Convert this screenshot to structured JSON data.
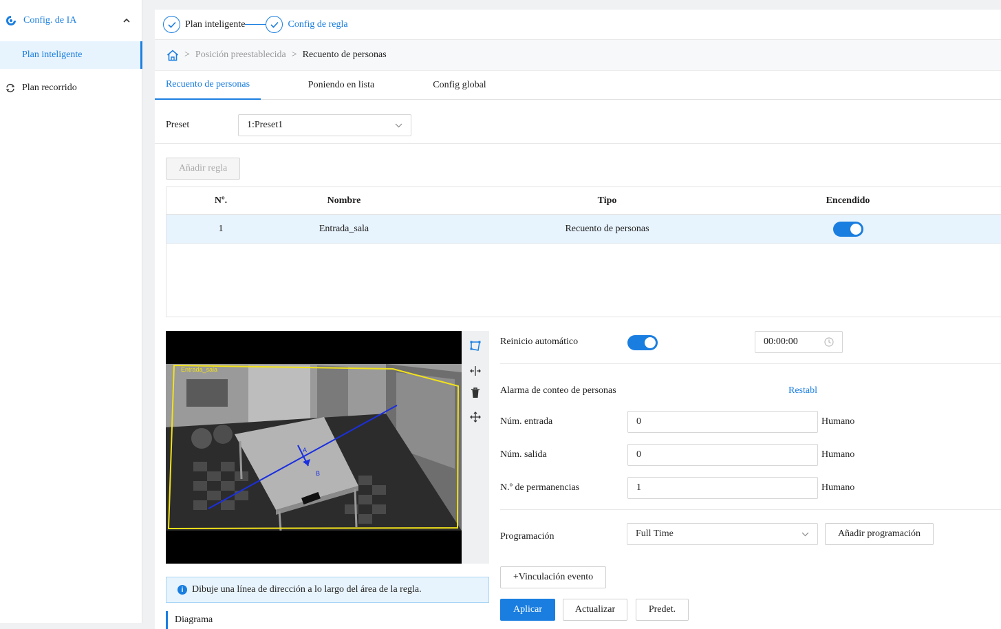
{
  "sidebar": {
    "group_label": "Config. de IA",
    "items": [
      {
        "label": "Plan inteligente"
      },
      {
        "label": "Plan recorrido"
      }
    ]
  },
  "steps": [
    {
      "label": "Plan inteligente"
    },
    {
      "label": "Config de regla"
    }
  ],
  "breadcrumb": {
    "parent": "Posición preestablecida",
    "current": "Recuento de personas",
    "separator": ">"
  },
  "tabs": [
    {
      "label": "Recuento de personas"
    },
    {
      "label": "Poniendo en lista"
    },
    {
      "label": "Config global"
    }
  ],
  "preset": {
    "label": "Preset",
    "value": "1:Preset1"
  },
  "add_rule_label": "Añadir regla",
  "table": {
    "headers": [
      "Nº.",
      "Nombre",
      "Tipo",
      "Encendido"
    ],
    "rows": [
      {
        "no": "1",
        "name": "Entrada_sala",
        "type": "Recuento de personas",
        "enabled": true
      }
    ]
  },
  "video": {
    "rule_name": "Entrada_sala",
    "point_a": "A",
    "point_b": "B"
  },
  "info_text": "Dibuje una línea de dirección a lo largo del área de la regla.",
  "diagram_label": "Diagrama",
  "settings": {
    "auto_reset_label": "Reinicio automático",
    "auto_reset_enabled": true,
    "auto_reset_time": "00:00:00",
    "alarm_label": "Alarma de conteo de personas",
    "reset_link": "Restabl",
    "entry_label": "Núm. entrada",
    "entry_value": "0",
    "exit_label": "Núm. salida",
    "exit_value": "0",
    "stay_label": "N.º de permanencias",
    "stay_value": "1",
    "unit": "Humano",
    "schedule_label": "Programación",
    "schedule_value": "Full Time",
    "add_schedule_label": "Añadir programación",
    "event_link_label": "+Vinculación evento"
  },
  "buttons": {
    "apply": "Aplicar",
    "refresh": "Actualizar",
    "default": "Predet."
  },
  "colors": {
    "accent": "#1a7ee0",
    "rule_box": "#f2e21a",
    "direction_line": "#1a2fe0"
  }
}
